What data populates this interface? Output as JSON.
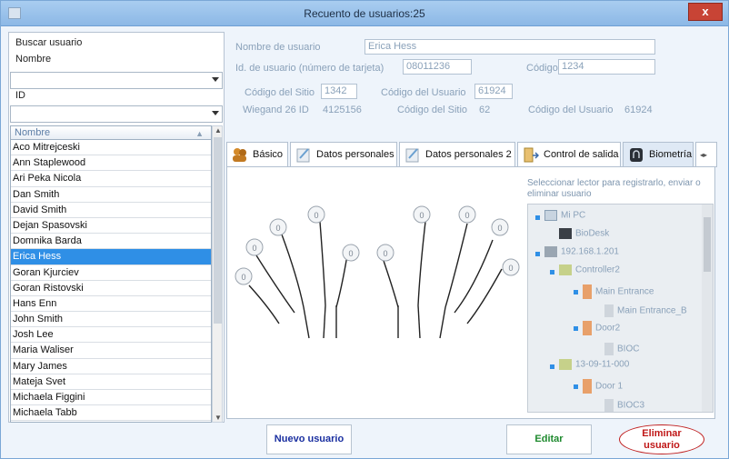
{
  "window": {
    "title": "Recuento de usuarios:25",
    "close": "x"
  },
  "search": {
    "heading": "Buscar usuario",
    "name_label": "Nombre",
    "id_label": "ID",
    "list_header": "Nombre"
  },
  "users": [
    "Aco Mitrejceski",
    "Ann Staplewood",
    "Ari Peka Nicola",
    "Dan Smith",
    "David Smith",
    "Dejan Spasovski",
    "Domnika Barda",
    "Erica Hess",
    "Goran Kjurciev",
    "Goran Ristovski",
    "Hans Enn",
    "John Smith",
    "Josh Lee",
    "Maria Waliser",
    "Mary James",
    "Mateja Svet",
    "Michaela Figgini",
    "Michaela Tabb"
  ],
  "selected_user": "Erica Hess",
  "details": {
    "name_label": "Nombre de usuario",
    "name_value": "Erica Hess",
    "id_label": "Id. de usuario (número de tarjeta)",
    "id_value": "08011236",
    "code_label": "Código",
    "code_value": "1234",
    "site_code_label": "Código del Sitio",
    "site_code_value": "1342",
    "user_code_label": "Código del Usuario",
    "user_code_value": "61924",
    "wiegand_label": "Wiegand 26  ID",
    "wiegand_value": "4125156",
    "site_code_label2": "Código del Sitio",
    "site_code_value2": "62",
    "user_code_label2": "Código del Usuario",
    "user_code_value2": "61924"
  },
  "tabs": [
    {
      "label": "Básico",
      "icon": "people-icon"
    },
    {
      "label": "Datos personales",
      "icon": "notes-icon"
    },
    {
      "label": "Datos personales 2",
      "icon": "notes-icon"
    },
    {
      "label": "Control de salida",
      "icon": "door-exit-icon"
    },
    {
      "label": "Biometría",
      "icon": "fingerprint-icon"
    }
  ],
  "active_tab": "Biometría",
  "biometrics": {
    "hint": "Seleccionar lector para registrarlo, enviar o eliminar usuario",
    "finger_count": "0"
  },
  "tree": {
    "root": "Mi PC",
    "biodesk": "BioDesk",
    "ip": "192.168.1.201",
    "controller": "Controller2",
    "main_entrance": "Main Entrance",
    "main_entrance_dev": "Main Entrance_B",
    "door2": "Door2",
    "bioc": "BIOC",
    "id2": "13-09-11-000",
    "door1": "Door 1",
    "bioc3": "BIOC3"
  },
  "buttons": {
    "new_user": "Nuevo usuario",
    "edit": "Editar",
    "delete": "Eliminar usuario"
  },
  "colors": {
    "selection": "#2f8fe6",
    "new_user_text": "#1a2fa0",
    "edit_text": "#1e8a2e",
    "delete_text": "#c01818"
  }
}
